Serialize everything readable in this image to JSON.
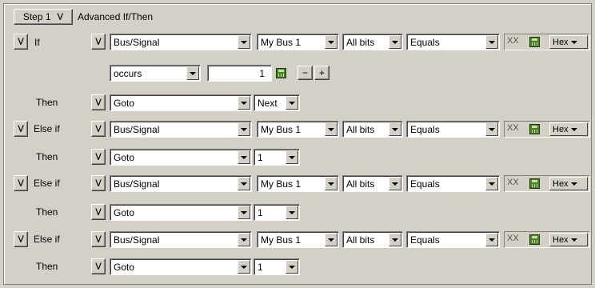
{
  "header": {
    "step_label": "Step 1",
    "title": "Advanced If/Then"
  },
  "if_row": {
    "label": "If",
    "signal": "Bus/Signal",
    "bus": "My Bus 1",
    "bits": "All bits",
    "operator": "Equals",
    "value": "XX",
    "radix": "Hex"
  },
  "occurs_row": {
    "mode": "occurs",
    "count": "1",
    "minus": "−",
    "plus": "+"
  },
  "then_rows": [
    {
      "label": "Then",
      "action": "Goto",
      "target": "Next"
    },
    {
      "label": "Then",
      "action": "Goto",
      "target": "1"
    },
    {
      "label": "Then",
      "action": "Goto",
      "target": "1"
    },
    {
      "label": "Then",
      "action": "Goto",
      "target": "1"
    }
  ],
  "elseif_rows": [
    {
      "label": "Else if",
      "signal": "Bus/Signal",
      "bus": "My Bus 1",
      "bits": "All bits",
      "operator": "Equals",
      "value": "XX",
      "radix": "Hex"
    },
    {
      "label": "Else if",
      "signal": "Bus/Signal",
      "bus": "My Bus 1",
      "bits": "All bits",
      "operator": "Equals",
      "value": "XX",
      "radix": "Hex"
    },
    {
      "label": "Else if",
      "signal": "Bus/Signal",
      "bus": "My Bus 1",
      "bits": "All bits",
      "operator": "Equals",
      "value": "XX",
      "radix": "Hex"
    }
  ],
  "icons": {
    "menu": "chevron-down-double-icon",
    "calculator": "calculator-icon",
    "dropdown": "dropdown-arrow-icon"
  }
}
